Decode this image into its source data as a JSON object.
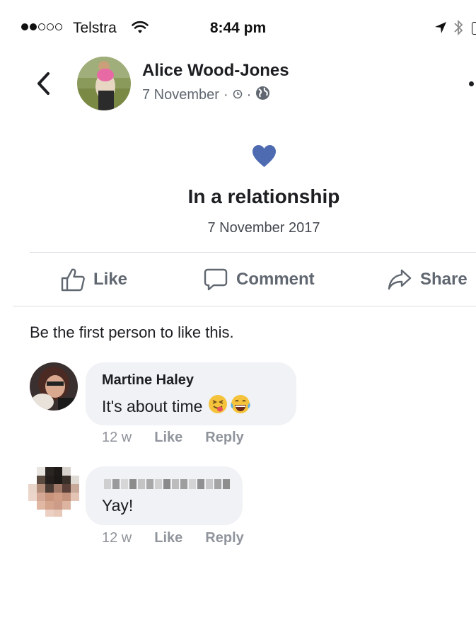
{
  "status_bar": {
    "carrier": "Telstra",
    "time": "8:44 pm",
    "signal_bars_filled": 2,
    "signal_bars_total": 5
  },
  "post": {
    "author": "Alice Wood-Jones",
    "date": "7 November",
    "separator": "·",
    "audience_icon": "globe-icon",
    "time_icon": "clock-icon"
  },
  "life_event": {
    "icon": "heart-icon",
    "icon_color": "#4e6bb2",
    "title": "In a relationship",
    "date": "7 November 2017"
  },
  "actions": {
    "like": "Like",
    "comment": "Comment",
    "share": "Share"
  },
  "likes_summary": "Be the first person to like this.",
  "comments": [
    {
      "author": "Martine Haley",
      "text": "It's about time",
      "emojis": [
        "😝",
        "😂"
      ],
      "age": "12 w",
      "like_label": "Like",
      "reply_label": "Reply"
    },
    {
      "author": "",
      "author_redacted": true,
      "text": "Yay!",
      "age": "12 w",
      "like_label": "Like",
      "reply_label": "Reply"
    }
  ]
}
